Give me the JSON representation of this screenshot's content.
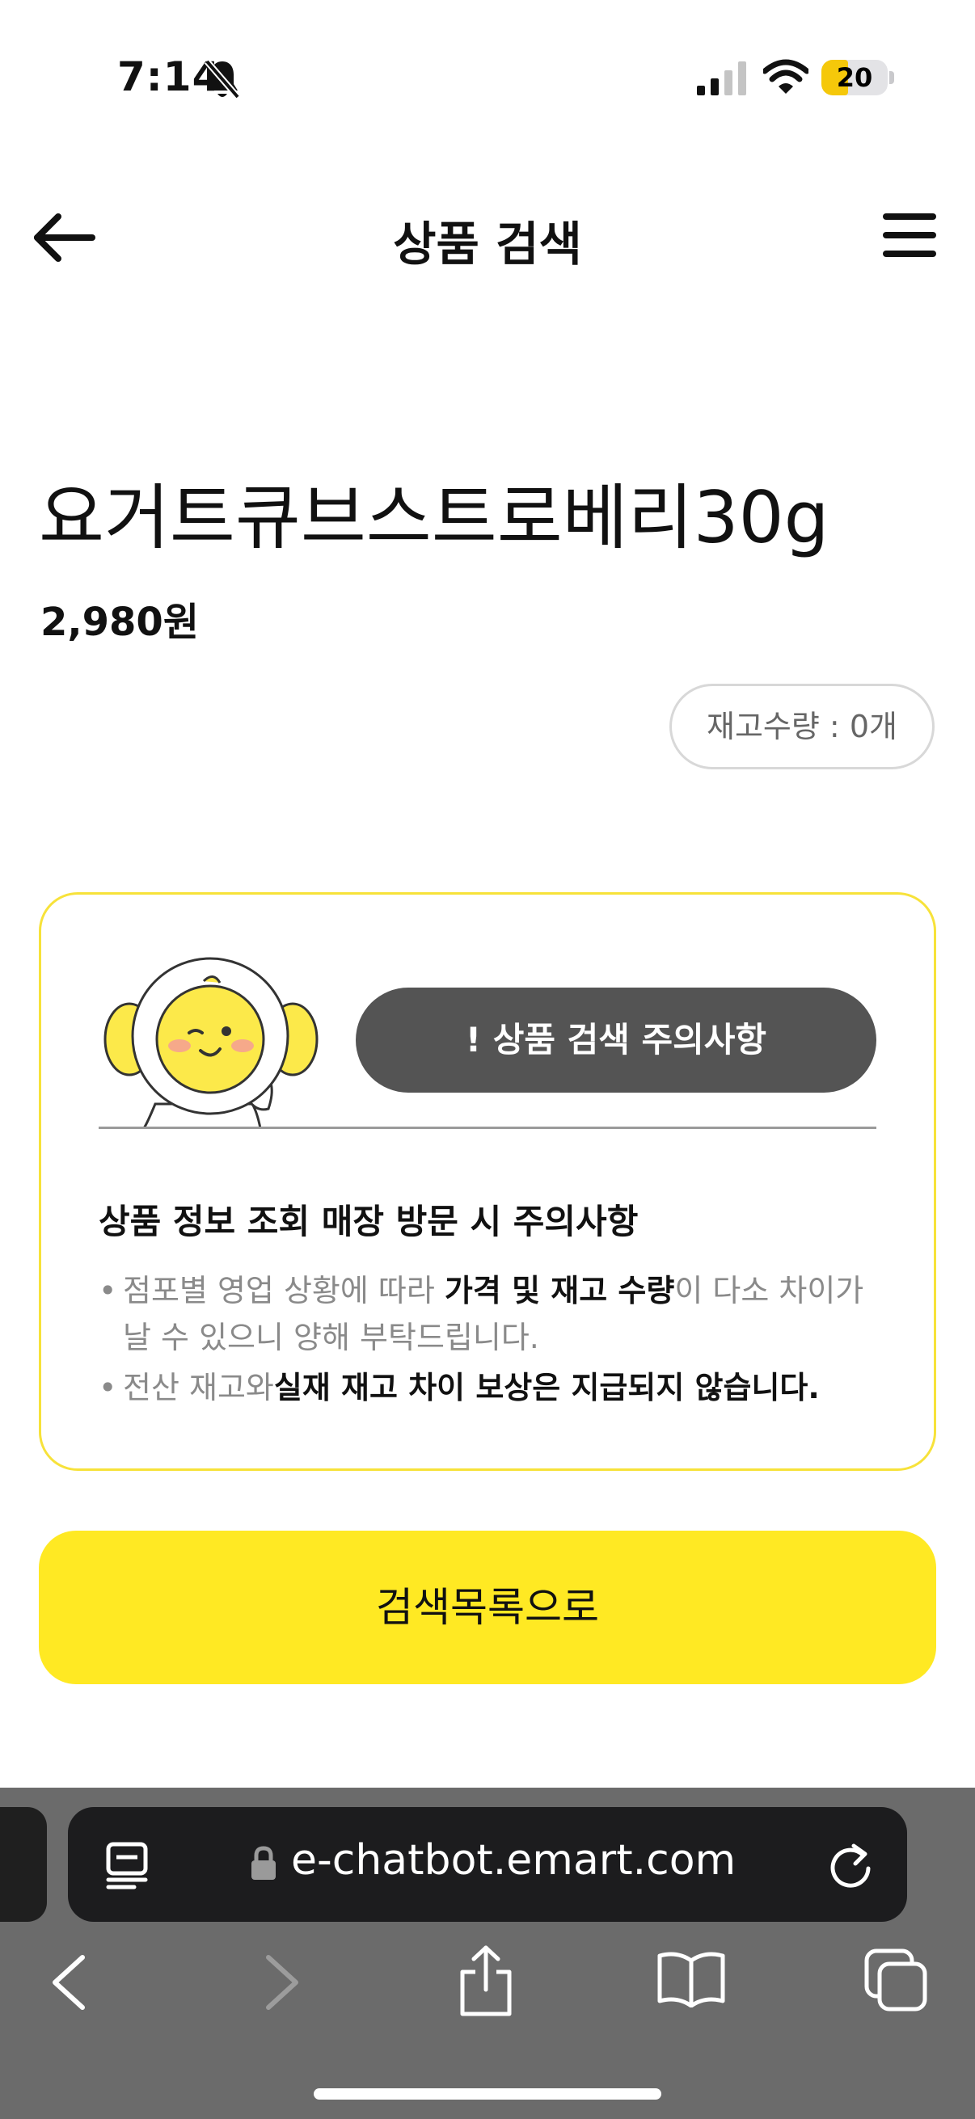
{
  "status_bar": {
    "time": "7:14",
    "battery": "20",
    "battery_level": 0.2
  },
  "header": {
    "title": "상품 검색"
  },
  "product": {
    "name": "요거트큐브스트로베리30g",
    "price": "2,980원",
    "stock_label": "재고수량 : 0개"
  },
  "notice": {
    "pill_label": "! 상품 검색 주의사항",
    "heading": "상품 정보 조회 매장 방문 시 주의사항",
    "bullet1_pre": "점포별 영업 상황에 따라 ",
    "bullet1_bold": "가격 및 재고 수량",
    "bullet1_post": "이 다소 차이가",
    "bullet1_cont": "날 수 있으니 양해 부탁드립니다.",
    "bullet2_pre": "전산 재고와",
    "bullet2_bold": "실재 재고 차이 보상은 지급되지 않습니다."
  },
  "cta": {
    "label": "검색목록으로"
  },
  "browser": {
    "url": "e-chatbot.emart.com"
  },
  "colors": {
    "accent": "#ffe923",
    "card_border": "#f7e23a",
    "pill_bg": "#545454",
    "browser_bg": "#6b6b6b"
  },
  "icons": [
    "bell-slash-icon",
    "signal-icon",
    "wifi-icon",
    "back-arrow-icon",
    "menu-icon",
    "reader-icon",
    "lock-icon",
    "reload-icon",
    "chevron-left-icon",
    "chevron-right-icon",
    "share-icon",
    "bookmarks-icon",
    "tabs-icon"
  ]
}
